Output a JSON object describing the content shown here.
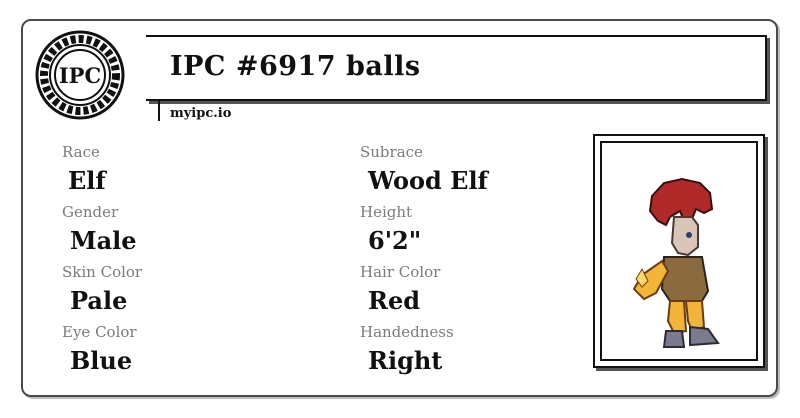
{
  "header": {
    "logo_text": "IPC",
    "title": "IPC #6917 balls",
    "site": "myipc.io"
  },
  "fields": [
    {
      "label": "Race",
      "value": "Elf"
    },
    {
      "label": "Subrace",
      "value": "Wood Elf"
    },
    {
      "label": "Gender",
      "value": "Male"
    },
    {
      "label": "Height",
      "value": "6'2\""
    },
    {
      "label": "Skin Color",
      "value": "Pale"
    },
    {
      "label": "Hair Color",
      "value": "Red"
    },
    {
      "label": "Eye Color",
      "value": "Blue"
    },
    {
      "label": "Handedness",
      "value": "Right"
    }
  ],
  "colors": {
    "label": "#7b7b7b",
    "value": "#111111",
    "border": "#4a4a4a",
    "hair": "#b02a2a",
    "armor": "#f2b53a"
  },
  "icons": [
    "ipc-logo",
    "character-sprite"
  ]
}
